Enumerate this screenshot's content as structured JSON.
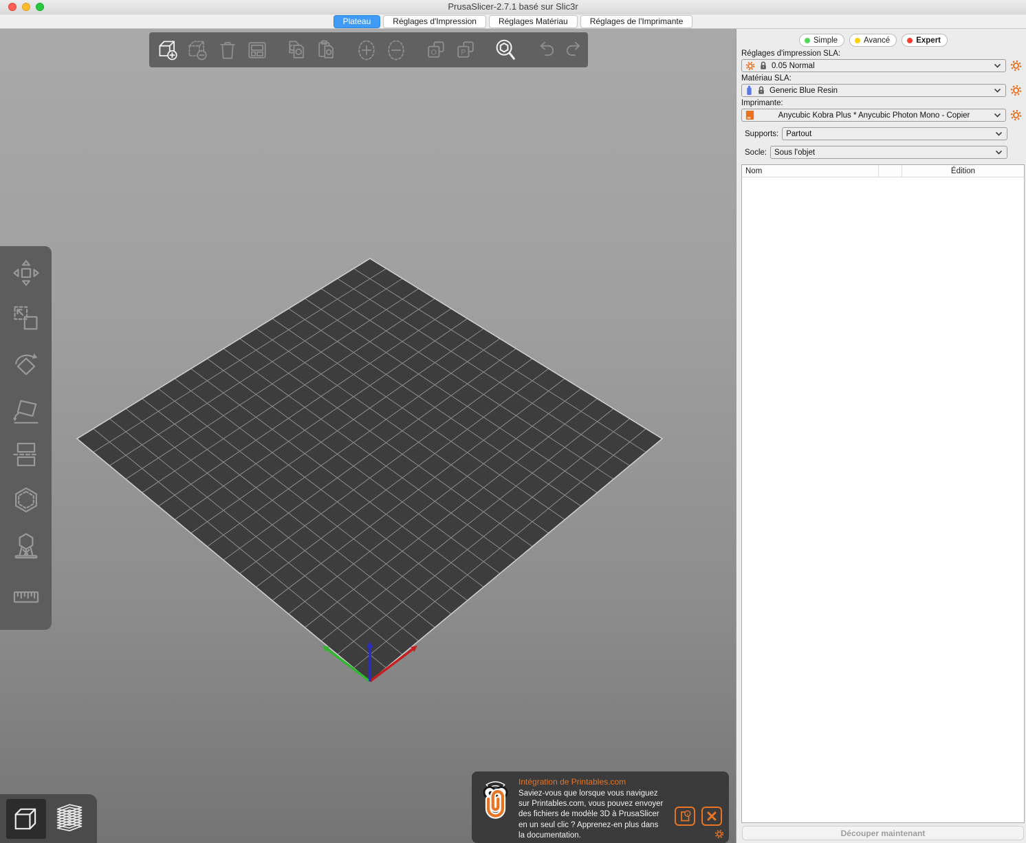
{
  "window": {
    "title": "PrusaSlicer-2.7.1 basé sur Slic3r"
  },
  "tabs": [
    {
      "label": "Plateau",
      "active": true
    },
    {
      "label": "Réglages d'Impression",
      "active": false
    },
    {
      "label": "Réglages Matériau",
      "active": false
    },
    {
      "label": "Réglages de l'Imprimante",
      "active": false
    }
  ],
  "top_toolbar": {
    "icons": [
      "add-object",
      "remove-object",
      "delete-all",
      "arrange",
      "copy",
      "paste",
      "add-instance",
      "remove-instance",
      "split-to-objects",
      "split-to-parts",
      "search",
      "undo",
      "redo"
    ],
    "enabled": [
      "add-object",
      "search"
    ]
  },
  "left_toolbar": {
    "icons": [
      "move",
      "scale",
      "rotate",
      "place-on-face",
      "cut",
      "hollow-drill",
      "sla-supports",
      "measure"
    ]
  },
  "viewport": {
    "view_toggle": [
      "3d-editor-view",
      "layers-preview-view"
    ],
    "axes": [
      "x-red",
      "y-green",
      "z-blue"
    ]
  },
  "sidebar": {
    "modes": [
      {
        "label": "Simple",
        "color": "#52d858",
        "active": false
      },
      {
        "label": "Avancé",
        "color": "#ffcf00",
        "active": false
      },
      {
        "label": "Expert",
        "color": "#ff3a2f",
        "active": true
      }
    ],
    "print_settings": {
      "label": "Réglages d'impression SLA:",
      "value": "0.05 Normal"
    },
    "material": {
      "label": "Matériau SLA:",
      "value": "Generic Blue Resin"
    },
    "printer": {
      "label": "Imprimante:",
      "value": "Anycubic Kobra Plus * Anycubic Photon Mono - Copier"
    },
    "supports": {
      "label": "Supports:",
      "value": "Partout"
    },
    "pad": {
      "label": "Socle:",
      "value": "Sous l'objet"
    },
    "object_list": {
      "columns": [
        "Nom",
        "Édition"
      ]
    },
    "slice_button": "Découper maintenant"
  },
  "notification": {
    "title": "Intégration de Printables.com",
    "body": "Saviez-vous que lorsque vous naviguez sur Printables.com, vous pouvez envoyer des fichiers de modèle 3D à PrusaSlicer en un seul clic ? Apprenez-en plus dans la documentation.",
    "buttons": [
      "open-documentation",
      "close"
    ]
  },
  "colors": {
    "accent": "#e87425",
    "tab_active": "#3f9bf5",
    "bed": "#3d3d3d"
  }
}
